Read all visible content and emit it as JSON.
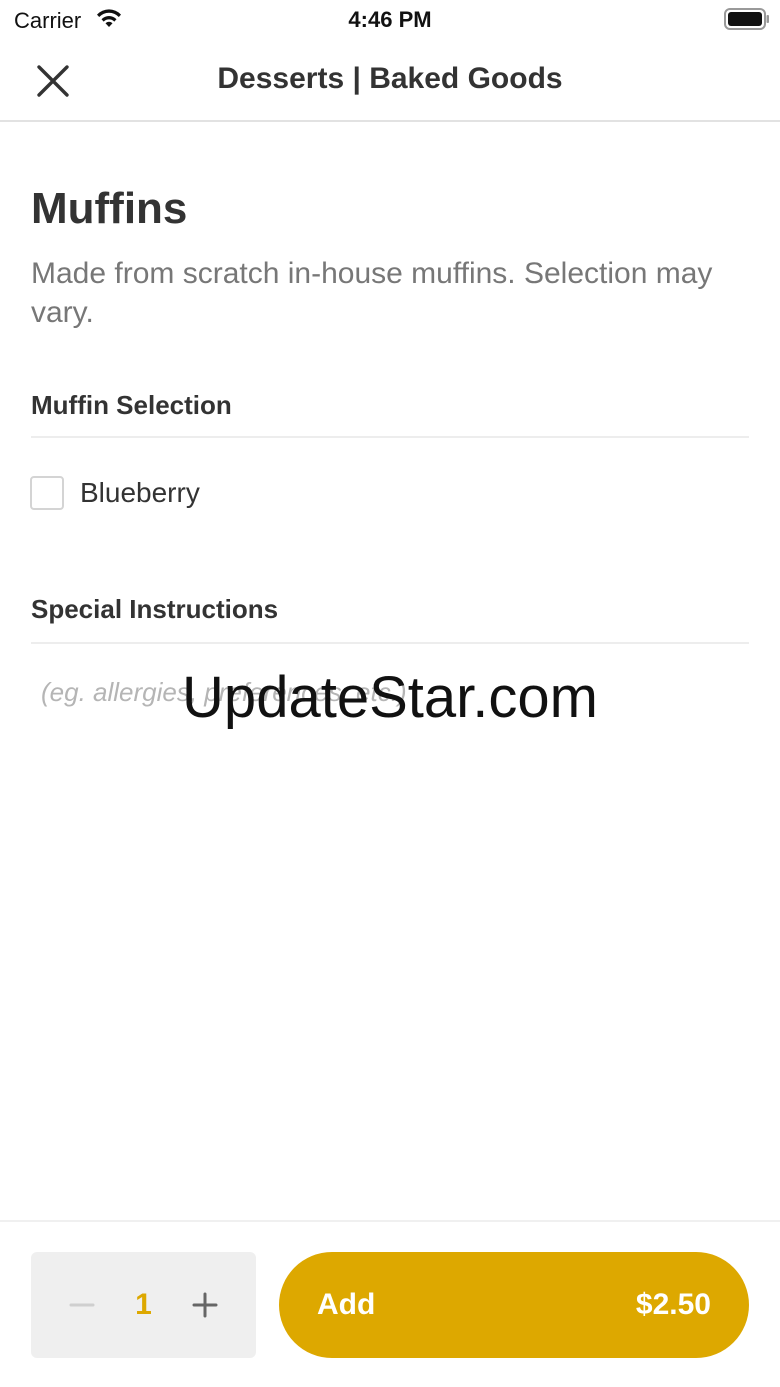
{
  "status_bar": {
    "carrier": "Carrier",
    "time": "4:46 PM"
  },
  "nav": {
    "title": "Desserts | Baked Goods",
    "close_icon": "close-icon"
  },
  "item": {
    "title": "Muffins",
    "description": "Made from scratch in-house muffins. Selection may vary."
  },
  "options_section": {
    "title": "Muffin Selection",
    "options": [
      {
        "label": "Blueberry",
        "checked": false
      }
    ]
  },
  "instructions_section": {
    "title": "Special Instructions",
    "placeholder": "(eg. allergies, preferences, etc.)"
  },
  "watermark": "UpdateStar.com",
  "footer": {
    "quantity": "1",
    "add_label": "Add",
    "price": "$2.50"
  },
  "colors": {
    "accent": "#dda800",
    "text": "#333333",
    "muted": "#777777"
  }
}
